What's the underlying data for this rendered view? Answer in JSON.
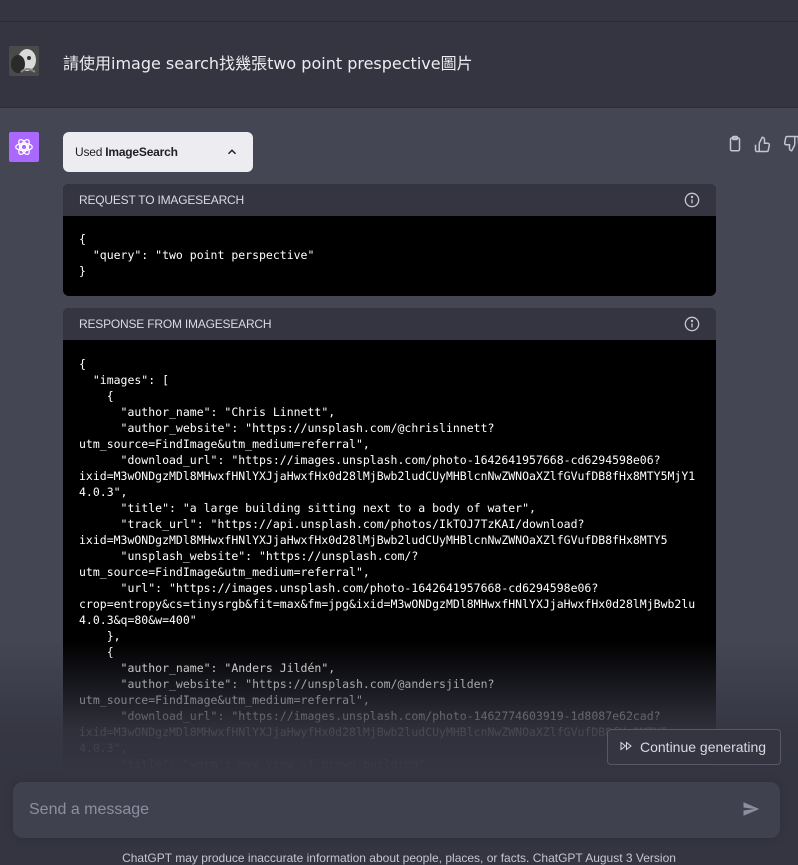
{
  "user_message": "請使用image search找幾張two point prespective圖片",
  "plugin": {
    "used_label": "Used",
    "name": "ImageSearch"
  },
  "request_panel": {
    "title": "REQUEST TO IMAGESEARCH",
    "body": "{\n  \"query\": \"two point perspective\"\n}"
  },
  "response_panel": {
    "title": "RESPONSE FROM IMAGESEARCH",
    "body": "{\n  \"images\": [\n    {\n      \"author_name\": \"Chris Linnett\",\n      \"author_website\": \"https://unsplash.com/@chrislinnett?\nutm_source=FindImage&utm_medium=referral\",\n      \"download_url\": \"https://images.unsplash.com/photo-1642641957668-cd6294598e06?\nixid=M3wONDgzMDl8MHwxfHNlYXJjaHwxfHx0d28lMjBwb2ludCUyMHBlcnNwZWNOaXZlfGVufDB8fHx8MTY5MjY1\n4.0.3\",\n      \"title\": \"a large building sitting next to a body of water\",\n      \"track_url\": \"https://api.unsplash.com/photos/IkTOJ7TzKAI/download?\nixid=M3wONDgzMDl8MHwxfHNlYXJjaHwxfHx0d28lMjBwb2ludCUyMHBlcnNwZWNOaXZlfGVufDB8fHx8MTY5\n      \"unsplash_website\": \"https://unsplash.com/?\nutm_source=FindImage&utm_medium=referral\",\n      \"url\": \"https://images.unsplash.com/photo-1642641957668-cd6294598e06?\ncrop=entropy&cs=tinysrgb&fit=max&fm=jpg&ixid=M3wONDgzMDl8MHwxfHNlYXJjaHwxfHx0d28lMjBwb2lu\n4.0.3&q=80&w=400\"\n    },\n    {\n      \"author_name\": \"Anders Jildén\",\n      \"author_website\": \"https://unsplash.com/@andersjilden?\nutm_source=FindImage&utm_medium=referral\",\n      \"download_url\": \"https://images.unsplash.com/photo-1462774603919-1d8087e62cad?\nixid=M3wONDgzMDl8MHwxfHNlYXJjaHwyfHx0d28lMjBwb2ludCUyMHBlcnNwZWNOaXZlfGVufDB8fHx8MTY5\n4.0.3\",\n      \"title\": \"worm's eye view of brown building\",\n      \"track_url\": \"https://api.unsplash.com/photos/TZCehSn-I-o/download?"
  },
  "continue_label": "Continue generating",
  "composer": {
    "placeholder": "Send a message"
  },
  "footer": "ChatGPT may produce inaccurate information about people, places, or facts. ChatGPT August 3 Version",
  "colors": {
    "gpt_plugin": "#ab68ff",
    "panel_bg": "#000000",
    "page_bg": "#343541",
    "assistant_bg": "#444654"
  },
  "icons": [
    "chatgpt-logo-icon",
    "chevron-up-icon",
    "clipboard-icon",
    "thumbs-up-icon",
    "thumbs-down-icon",
    "info-icon",
    "fast-forward-icon",
    "send-icon"
  ]
}
